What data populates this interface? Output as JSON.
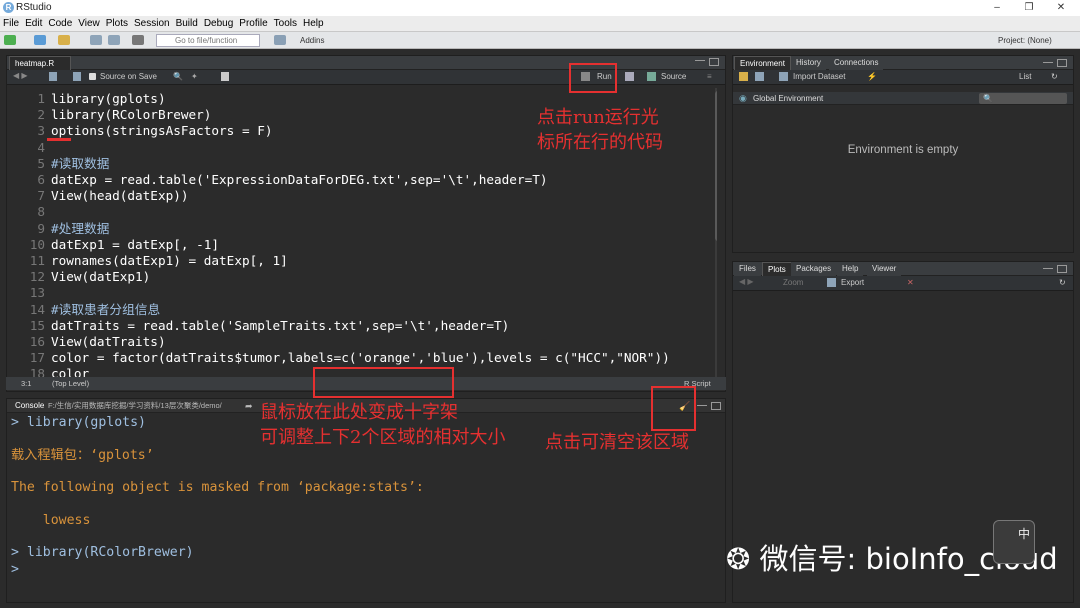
{
  "window": {
    "title": "RStudio",
    "controls": [
      "–",
      "❐",
      "✕"
    ]
  },
  "menu": [
    "File",
    "Edit",
    "Code",
    "View",
    "Plots",
    "Session",
    "Build",
    "Debug",
    "Profile",
    "Tools",
    "Help"
  ],
  "toolbar": {
    "goto_placeholder": "Go to file/function",
    "addins": "Addins",
    "project": "Project: (None)"
  },
  "editor": {
    "tab_label": "heatmap.R",
    "source_on_save": "Source on Save",
    "run_label": "Run",
    "source_label": "Source",
    "lines": [
      {
        "n": "1",
        "text": "library(gplots)"
      },
      {
        "n": "2",
        "text": "library(RColorBrewer)"
      },
      {
        "n": "3",
        "text": "options(stringsAsFactors = F)"
      },
      {
        "n": "4",
        "text": ""
      },
      {
        "n": "5",
        "text": "#读取数据"
      },
      {
        "n": "6",
        "text": "datExp = read.table('ExpressionDataForDEG.txt',sep='\\t',header=T)"
      },
      {
        "n": "7",
        "text": "View(head(datExp))"
      },
      {
        "n": "8",
        "text": ""
      },
      {
        "n": "9",
        "text": "#处理数据"
      },
      {
        "n": "10",
        "text": "datExp1 = datExp[, -1]"
      },
      {
        "n": "11",
        "text": "rownames(datExp1) = datExp[, 1]"
      },
      {
        "n": "12",
        "text": "View(datExp1)"
      },
      {
        "n": "13",
        "text": ""
      },
      {
        "n": "14",
        "text": "#读取患者分组信息"
      },
      {
        "n": "15",
        "text": "datTraits = read.table('SampleTraits.txt',sep='\\t',header=T)"
      },
      {
        "n": "16",
        "text": "View(datTraits)"
      },
      {
        "n": "17",
        "text": "color = factor(datTraits$tumor,labels=c('orange','blue'),levels = c(\"HCC\",\"NOR\"))"
      },
      {
        "n": "18",
        "text": "color"
      }
    ],
    "status_pos": "3:1",
    "status_level": "(Top Level)",
    "status_type": "R Script"
  },
  "annotations": {
    "run_note_1": "点击run运行光",
    "run_note_2": "标所在行的代码",
    "resize_note_1": "鼠标放在此处变成十字架",
    "resize_note_2": "可调整上下2个区域的相对大小",
    "clear_note": "点击可清空该区域"
  },
  "console": {
    "label": "Console",
    "path": "F:/生信/实用数据库挖掘/学习资料/13层次聚类/demo/",
    "lines": [
      {
        "cls": "prompt",
        "text": "> library(gplots)"
      },
      {
        "cls": "warn",
        "text": ""
      },
      {
        "cls": "warn",
        "text": "载入程辑包：‘gplots’"
      },
      {
        "cls": "warn",
        "text": ""
      },
      {
        "cls": "warn",
        "text": "The following object is masked from ‘package:stats’:"
      },
      {
        "cls": "warn",
        "text": ""
      },
      {
        "cls": "warn",
        "text": "    lowess"
      },
      {
        "cls": "warn",
        "text": ""
      },
      {
        "cls": "prompt",
        "text": "> library(RColorBrewer)"
      },
      {
        "cls": "prompt",
        "text": "> "
      }
    ]
  },
  "env": {
    "tabs": [
      "Environment",
      "History",
      "Connections"
    ],
    "import_label": "Import Dataset",
    "list_label": "List",
    "global_label": "Global Environment",
    "empty_text": "Environment is empty"
  },
  "files": {
    "tabs": [
      "Files",
      "Plots",
      "Packages",
      "Help",
      "Viewer"
    ],
    "zoom_label": "Zoom",
    "export_label": "Export"
  },
  "watermark": "微信号: bioInfo_cloud",
  "avatar_text": "中"
}
